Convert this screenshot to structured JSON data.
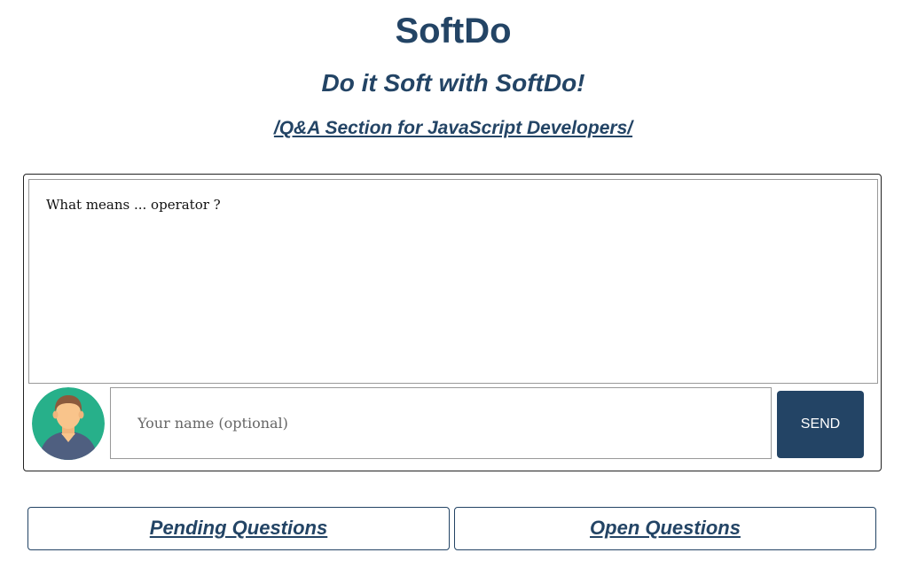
{
  "header": {
    "title": "SoftDo",
    "tagline": "Do it Soft with SoftDo!",
    "section_link": "/Q&A Section for JavaScript Developers/"
  },
  "question_form": {
    "question_value": "What means ... operator ?",
    "name_placeholder": "Your name (optional)",
    "name_value": "",
    "send_label": "SEND",
    "avatar_icon": "user-avatar-icon"
  },
  "nav": {
    "pending_label": "Pending Questions",
    "open_label": "Open Questions"
  },
  "colors": {
    "brand": "#234465",
    "avatar_bg": "#27b08a",
    "avatar_skin": "#f9c48b",
    "avatar_hair": "#8b5a3c",
    "avatar_shirt": "#4f5f80"
  }
}
